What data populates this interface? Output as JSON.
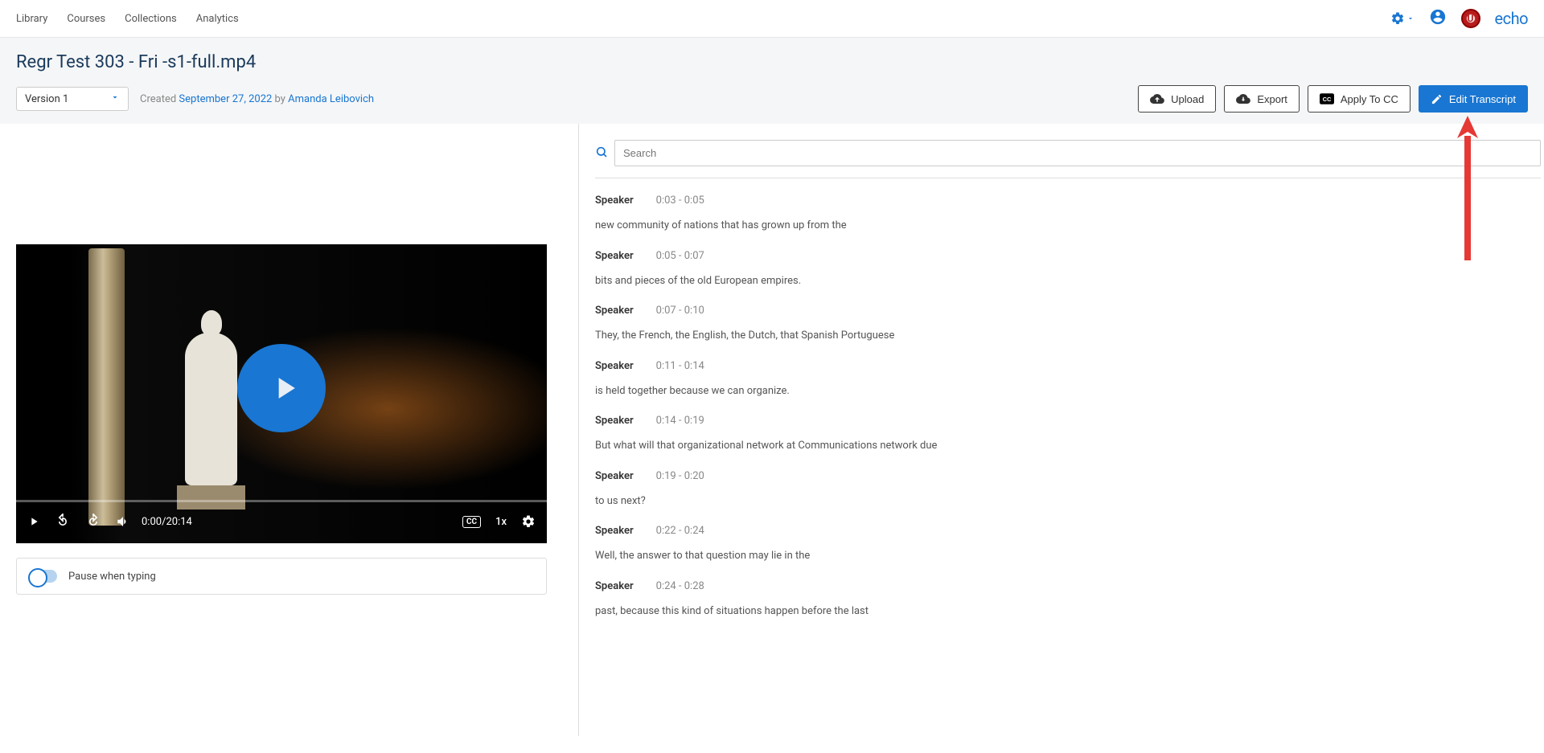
{
  "nav": {
    "links": [
      "Library",
      "Courses",
      "Collections",
      "Analytics"
    ],
    "logo": "echo"
  },
  "header": {
    "title": "Regr Test 303 - Fri -s1-full.mp4",
    "version": "Version 1",
    "created_label": "Created ",
    "created_date": "September 27, 2022",
    "by_label": " by ",
    "author": "Amanda Leibovich",
    "buttons": {
      "upload": "Upload",
      "export": "Export",
      "apply_cc": "Apply To CC",
      "edit_transcript": "Edit Transcript"
    }
  },
  "player": {
    "current": "0:00",
    "duration": "20:14",
    "speed": "1x",
    "cc": "CC"
  },
  "pause_toggle": "Pause when typing",
  "search": {
    "placeholder": "Search"
  },
  "transcript": [
    {
      "speaker": "Speaker",
      "time": "0:03 - 0:05",
      "text": "new community of nations that has grown up from the"
    },
    {
      "speaker": "Speaker",
      "time": "0:05 - 0:07",
      "text": "bits and pieces of the old European empires."
    },
    {
      "speaker": "Speaker",
      "time": "0:07 - 0:10",
      "text": "They, the French, the English, the Dutch, that Spanish Portuguese"
    },
    {
      "speaker": "Speaker",
      "time": "0:11 - 0:14",
      "text": "is held together because we can organize."
    },
    {
      "speaker": "Speaker",
      "time": "0:14 - 0:19",
      "text": "But what will that organizational network at Communications network due"
    },
    {
      "speaker": "Speaker",
      "time": "0:19 - 0:20",
      "text": "to us next?"
    },
    {
      "speaker": "Speaker",
      "time": "0:22 - 0:24",
      "text": "Well, the answer to that question may lie in the"
    },
    {
      "speaker": "Speaker",
      "time": "0:24 - 0:28",
      "text": "past, because this kind of situations happen before the last"
    }
  ]
}
